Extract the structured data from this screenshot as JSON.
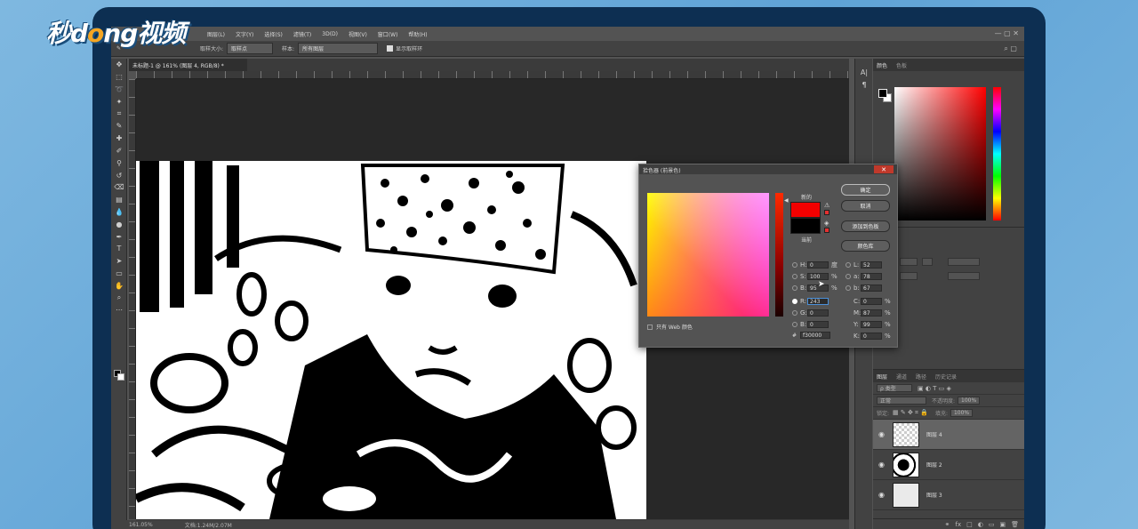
{
  "brand": {
    "logo_pre": "秒d",
    "logo_dot": "o",
    "logo_post": "ng视频"
  },
  "menu": [
    "图层(L)",
    "文字(Y)",
    "选择(S)",
    "滤镜(T)",
    "3D(D)",
    "视图(V)",
    "窗口(W)",
    "帮助(H)"
  ],
  "options": {
    "sample_size_label": "取样大小:",
    "sample_size_value": "取样点",
    "sample_label": "样本:",
    "sample_value": "所有图层",
    "show_ring_label": "显示取样环"
  },
  "document": {
    "tab_title": "未标题-1 @ 161% (图层 4, RGB/8) *",
    "zoom": "161.05%",
    "doc_size": "文档:1.24M/2.07M"
  },
  "color_panel": {
    "tab_color": "颜色",
    "tab_swatches": "色板"
  },
  "layers_panel": {
    "tabs": [
      "图层",
      "通道",
      "路径",
      "历史记录"
    ],
    "filter_label": "ρ 类型",
    "blend_mode": "正常",
    "opacity_label": "不透明度:",
    "opacity_value": "100%",
    "lock_label": "锁定:",
    "fill_label": "填充:",
    "fill_value": "100%",
    "layers": [
      {
        "name": "图层 4",
        "active": true
      },
      {
        "name": "图层 2",
        "active": false
      },
      {
        "name": "图层 3",
        "active": false
      }
    ],
    "bottom_icons": [
      "fx",
      "□",
      "◐",
      "▭",
      "▣",
      "🗑"
    ]
  },
  "picker": {
    "title": "拾色器 (前景色)",
    "new_label": "新的",
    "current_label": "当前",
    "new_color": "#f30000",
    "current_color": "#000000",
    "buttons": {
      "ok": "确定",
      "cancel": "取消",
      "add_swatch": "添加到色板",
      "libraries": "颜色库"
    },
    "web_only": "只有 Web 颜色",
    "hsb": {
      "H": "0",
      "S": "100",
      "B": "95",
      "H_unit": "度",
      "S_unit": "%",
      "B_unit": "%"
    },
    "rgb": {
      "R": "243",
      "G": "0",
      "B": "0"
    },
    "lab": {
      "L": "52",
      "a": "78",
      "b": "67"
    },
    "cmyk": {
      "C": "0",
      "M": "87",
      "Y": "99",
      "K": "0"
    },
    "hex": "f30000",
    "hex_label": "#"
  }
}
